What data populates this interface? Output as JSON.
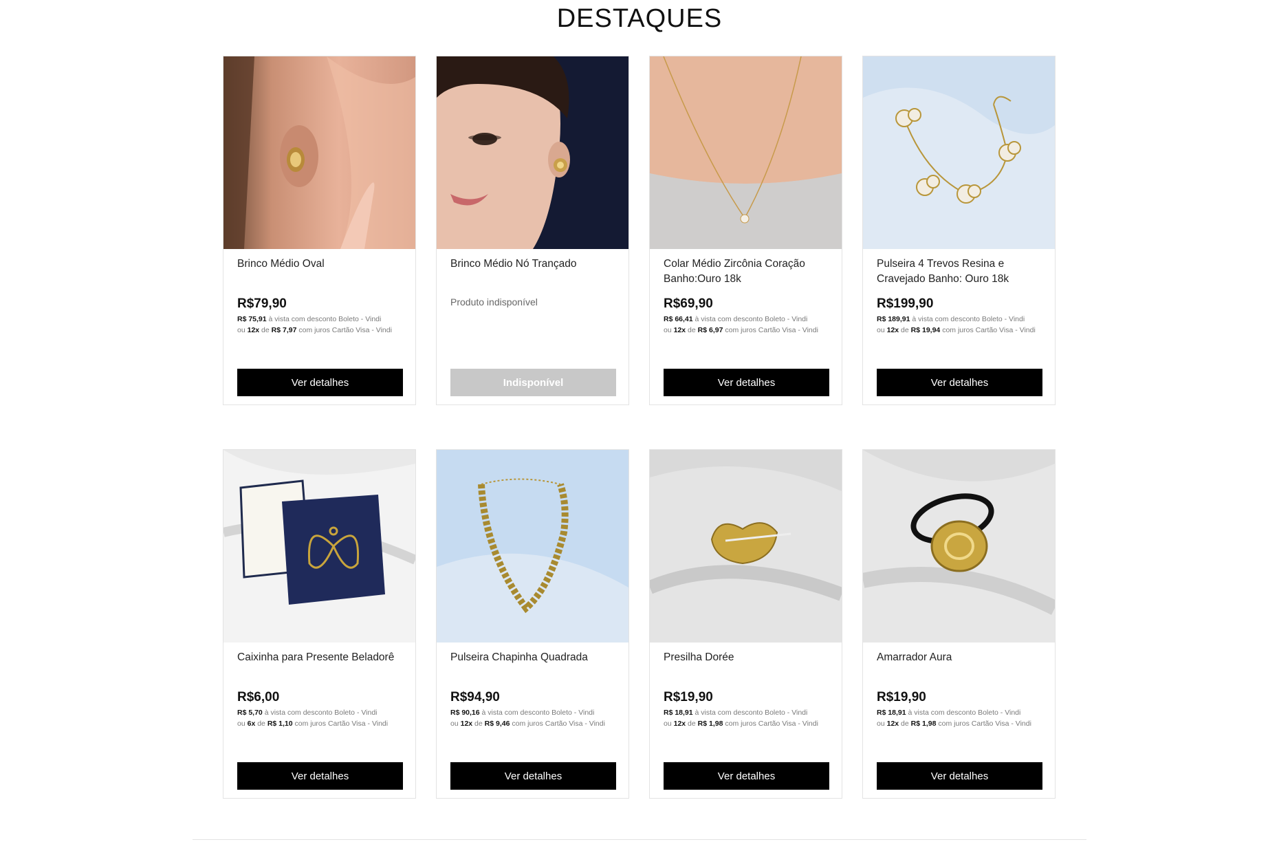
{
  "section": {
    "title": "DESTAQUES"
  },
  "products": [
    {
      "name": "Brinco Médio Oval",
      "price": "R$79,90",
      "boleto_price": "R$ 75,91",
      "boleto_text": " à vista com desconto Boleto - Vindi",
      "installments_prefix": "ou ",
      "installments_count": "12x",
      "installments_of": " de ",
      "installment_value": "R$ 7,97",
      "installments_text": " com juros Cartão Visa - Vindi",
      "button": "Ver detalhes",
      "image": "gold-oval-earring-photo"
    },
    {
      "name": "Brinco Médio Nó Trançado",
      "unavailable_text": "Produto indisponível",
      "button": "Indisponível",
      "image": "knot-earring-model-photo"
    },
    {
      "name": "Colar Médio Zircônia Coração Banho:Ouro 18k",
      "price": "R$69,90",
      "boleto_price": "R$ 66,41",
      "boleto_text": " à vista com desconto Boleto - Vindi",
      "installments_prefix": "ou ",
      "installments_count": "12x",
      "installments_of": " de ",
      "installment_value": "R$ 6,97",
      "installments_text": " com juros Cartão Visa - Vindi",
      "button": "Ver detalhes",
      "image": "heart-necklace-photo"
    },
    {
      "name": "Pulseira 4 Trevos Resina e Cravejado Banho: Ouro 18k",
      "price": "R$199,90",
      "boleto_price": "R$ 189,91",
      "boleto_text": " à vista com desconto Boleto - Vindi",
      "installments_prefix": "ou ",
      "installments_count": "12x",
      "installments_of": " de ",
      "installment_value": "R$ 19,94",
      "installments_text": " com juros Cartão Visa - Vindi",
      "button": "Ver detalhes",
      "image": "clover-bracelet-photo"
    },
    {
      "name": "Caixinha para Presente Beladorê",
      "price": "R$6,00",
      "boleto_price": "R$ 5,70",
      "boleto_text": " à vista com desconto Boleto - Vindi",
      "installments_prefix": "ou ",
      "installments_count": "6x",
      "installments_of": " de ",
      "installment_value": "R$ 1,10",
      "installments_text": " com juros Cartão Visa - Vindi",
      "button": "Ver detalhes",
      "image": "gift-box-photo"
    },
    {
      "name": "Pulseira Chapinha Quadrada",
      "price": "R$94,90",
      "boleto_price": "R$ 90,16",
      "boleto_text": " à vista com desconto Boleto - Vindi",
      "installments_prefix": "ou ",
      "installments_count": "12x",
      "installments_of": " de ",
      "installment_value": "R$ 9,46",
      "installments_text": " com juros Cartão Visa - Vindi",
      "button": "Ver detalhes",
      "image": "square-link-bracelet-photo"
    },
    {
      "name": "Presilha Dorée",
      "price": "R$19,90",
      "boleto_price": "R$ 18,91",
      "boleto_text": " à vista com desconto Boleto - Vindi",
      "installments_prefix": "ou ",
      "installments_count": "12x",
      "installments_of": " de ",
      "installment_value": "R$ 1,98",
      "installments_text": " com juros Cartão Visa - Vindi",
      "button": "Ver detalhes",
      "image": "heart-hair-clip-photo"
    },
    {
      "name": "Amarrador Aura",
      "price": "R$19,90",
      "boleto_price": "R$ 18,91",
      "boleto_text": " à vista com desconto Boleto - Vindi",
      "installments_prefix": "ou ",
      "installments_count": "12x",
      "installments_of": " de ",
      "installment_value": "R$ 1,98",
      "installments_text": " com juros Cartão Visa - Vindi",
      "button": "Ver detalhes",
      "image": "hair-tie-photo"
    }
  ],
  "colors": {
    "button_bg": "#000000",
    "button_disabled_bg": "#c8c8c8",
    "card_border": "#e3e3e3"
  }
}
